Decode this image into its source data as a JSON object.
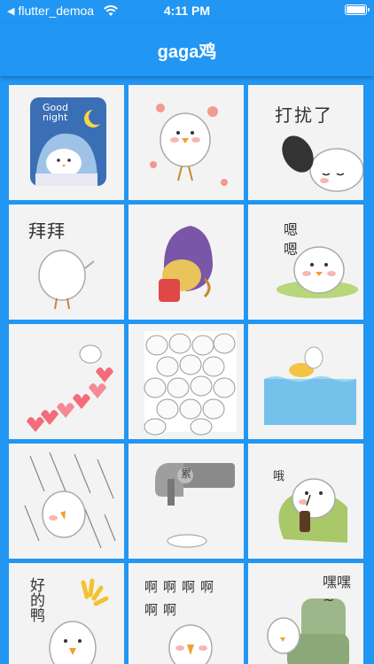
{
  "status_bar": {
    "back_app": "flutter_demoa",
    "time": "4:11 PM",
    "back_icon": "back-arrow-icon",
    "wifi_icon": "wifi-icon",
    "battery_icon": "battery-icon"
  },
  "app_bar": {
    "title": "gaga鸡"
  },
  "colors": {
    "primary": "#2196F3",
    "tile_bg": "#f3f3f3"
  },
  "stickers": [
    {
      "name": "sticker-good-night",
      "text": "Good night"
    },
    {
      "name": "sticker-flowers",
      "text": ""
    },
    {
      "name": "sticker-disturb",
      "text": "打扰了"
    },
    {
      "name": "sticker-bye",
      "text": "拜拜"
    },
    {
      "name": "sticker-hidden",
      "text": ""
    },
    {
      "name": "sticker-hmm",
      "text": "嗯嗯"
    },
    {
      "name": "sticker-hearts",
      "text": ""
    },
    {
      "name": "sticker-crowd",
      "text": ""
    },
    {
      "name": "sticker-swim",
      "text": ""
    },
    {
      "name": "sticker-rain",
      "text": ""
    },
    {
      "name": "sticker-tired",
      "text": "累"
    },
    {
      "name": "sticker-drink",
      "text": "哦"
    },
    {
      "name": "sticker-ok",
      "text": "好的鸭"
    },
    {
      "name": "sticker-aaa",
      "text": "啊啊啊啊啊啊"
    },
    {
      "name": "sticker-hehe",
      "text": "嘿嘿~"
    }
  ]
}
